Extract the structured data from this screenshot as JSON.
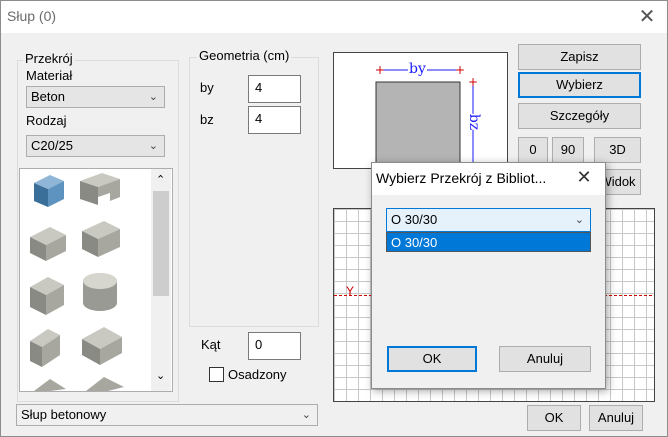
{
  "window": {
    "title": "Słup (0)"
  },
  "section": {
    "group_label": "Przekrój",
    "material_label": "Materiał",
    "material_value": "Beton",
    "type_label": "Rodzaj",
    "type_value": "C20/25"
  },
  "geometry": {
    "group_label": "Geometria (cm)",
    "by_label": "by",
    "by_value": "4",
    "bz_label": "bz",
    "bz_value": "4",
    "angle_label": "Kąt",
    "angle_value": "0",
    "embedded_label": "Osadzony"
  },
  "preview": {
    "by_label": "by",
    "bz_label": "bz",
    "y_label": "Y"
  },
  "buttons": {
    "save": "Zapisz",
    "choose": "Wybierz",
    "details": "Szczegóły",
    "rot0": "0",
    "rot90": "90",
    "view3d": "3D",
    "view": "Widok",
    "ok": "OK",
    "cancel": "Anuluj"
  },
  "bottom": {
    "element_type": "Słup betonowy"
  },
  "library_dialog": {
    "title": "Wybierz Przekrój z Bibliot...",
    "selected": "O 30/30",
    "options": [
      "O 30/30"
    ],
    "ok": "OK",
    "cancel": "Anuluj"
  },
  "colors": {
    "accent": "#0078d7",
    "selection": "#0078d7",
    "dimension": "#1a1aff",
    "marker": "#d00000"
  }
}
